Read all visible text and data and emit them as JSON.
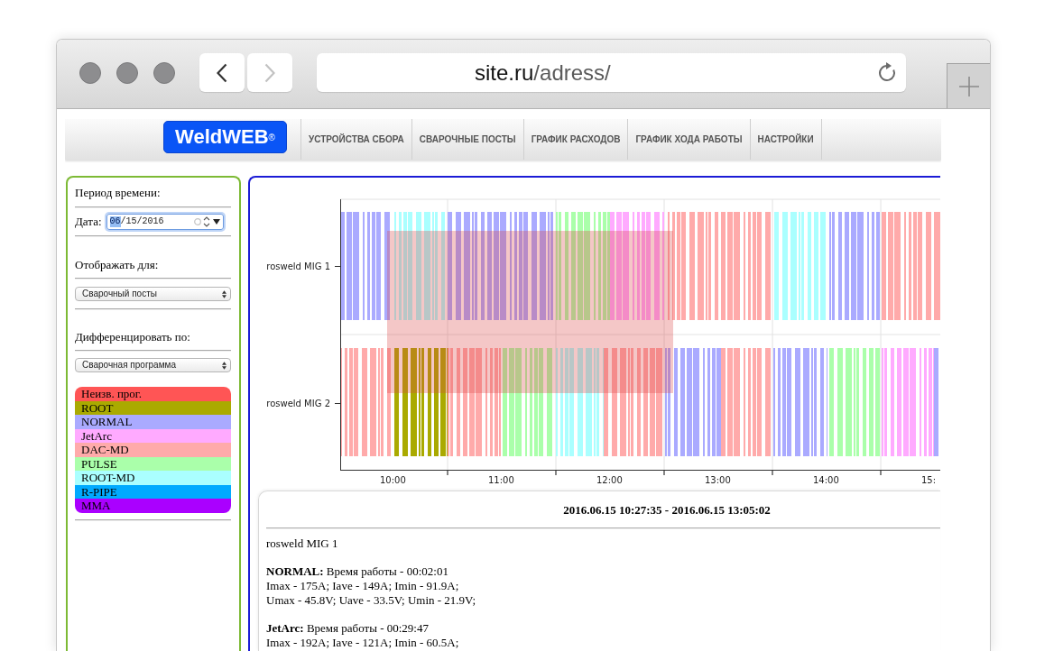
{
  "browser": {
    "back_button": {
      "disabled": false
    },
    "forward_button": {
      "disabled": true
    },
    "address_bar": {
      "host": "site.ru",
      "path": "/adress/"
    }
  },
  "nav": {
    "logo": "WeldWEB$^{®}$",
    "items": [
      {
        "label": "УСТРОЙСТВА СБОРА",
        "selected": false
      },
      {
        "label": "СВАРОЧНЫЕ ПОСТЫ",
        "selected": false
      },
      {
        "label": "ГРАФИК РАСХОДОВ",
        "selected": false
      },
      {
        "label": "ГРАФИК ХОДА РАБОТЫ",
        "selected": false
      },
      {
        "label": "НАСТРОЙКИ",
        "selected": false
      }
    ]
  },
  "sidebar": {
    "period_title": "Период времени:",
    "date": {
      "label": "Дата:",
      "focused": true,
      "parts": [
        {
          "text": "06",
          "selected": true
        },
        {
          "text": "/15/2016",
          "selected": false
        }
      ]
    },
    "display_for": {
      "label": "Отображать для:",
      "value": "Сварочный посты"
    },
    "differentiate_by": {
      "label": "Дифференцировать по:",
      "value": "Сварочная программа"
    },
    "legend": [
      {
        "label": "Неизв. прог.",
        "color": "#ff5555"
      },
      {
        "label": "ROOT",
        "color": "#aaaa00"
      },
      {
        "label": "NORMAL",
        "color": "#aaaaff"
      },
      {
        "label": "JetArc",
        "color": "#ffaaff"
      },
      {
        "label": "DAC-MD",
        "color": "#ffaaaa"
      },
      {
        "label": "PULSE",
        "color": "#aaffaa"
      },
      {
        "label": "ROOT-MD",
        "color": "#aaffff"
      },
      {
        "label": "R-PIPE",
        "color": "#00aaff"
      },
      {
        "label": "MMA",
        "color": "#aa00ff"
      }
    ]
  },
  "timeline": {
    "rows": [
      "rosweld MIG 1",
      "rosweld MIG 2"
    ],
    "ticks": [
      "10:00",
      "11:00",
      "12:00",
      "13:00",
      "14:00",
      "15:"
    ]
  },
  "summary": {
    "title": "2016.06.15 10:27:35 - 2016.06.15 13:05:02",
    "station": "rosweld MIG 1",
    "blocks": [
      {
        "heading": "**NORMAL:** Время работы - 00:02:01",
        "lines": [
          "Imax - 175A; Iave - 149A; Imin - 91.9A;",
          "Umax - 45.8V; Uave - 33.5V; Umin - 21.9V;"
        ]
      },
      {
        "heading": "**JetArc:** Время работы - 00:29:47",
        "lines": [
          "Imax - 192A; Iave - 121A; Imin - 60.5A;"
        ]
      }
    ]
  }
}
